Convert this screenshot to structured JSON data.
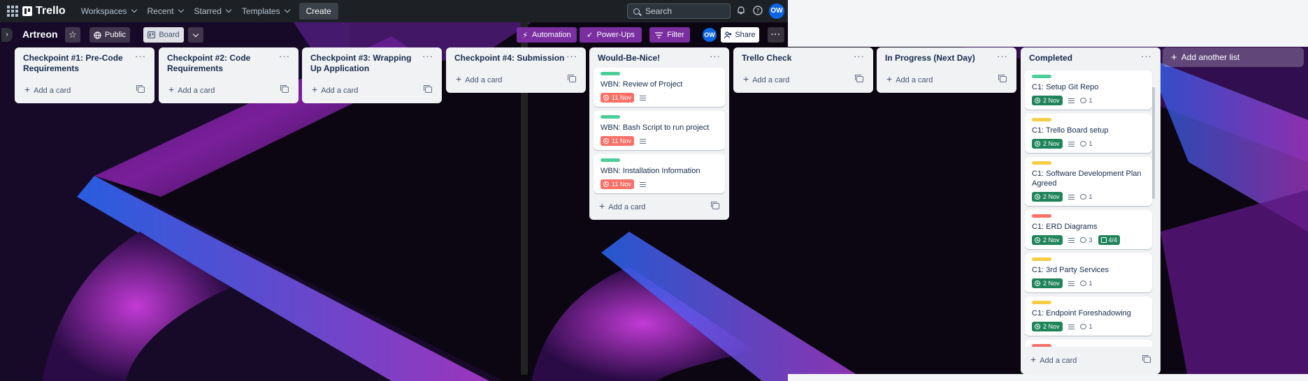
{
  "topnav": {
    "logo": "Trello",
    "items": [
      {
        "label": "Workspaces"
      },
      {
        "label": "Recent"
      },
      {
        "label": "Starred"
      },
      {
        "label": "Templates"
      }
    ],
    "create": "Create",
    "search_placeholder": "Search",
    "avatar": "OW"
  },
  "board": {
    "title": "Artreon",
    "visibility": "Public",
    "view": "Board",
    "automation": "Automation",
    "powerups": "Power-Ups",
    "filter": "Filter",
    "member_avatar": "OW",
    "share": "Share",
    "add_list": "Add another list"
  },
  "colors": {
    "green": "#4bce97",
    "yellow": "#f5cd47",
    "red": "#f87168",
    "date_green": "#1f845a",
    "date_red": "#f87168",
    "purple_accent": "#7a2ea0"
  },
  "lists": [
    {
      "title": "Checkpoint #1: Pre-Code Requirements",
      "add_card": "Add a card",
      "cards": []
    },
    {
      "title": "Checkpoint #2: Code Requirements",
      "add_card": "Add a card",
      "cards": []
    },
    {
      "title": "Checkpoint #3: Wrapping Up Application",
      "add_card": "Add a card",
      "cards": []
    },
    {
      "title": "Checkpoint #4: Submission",
      "add_card": "Add a card",
      "cards": []
    },
    {
      "title": "Would-Be-Nice!",
      "add_card": "Add a card",
      "cards": [
        {
          "label": "green",
          "title": "WBN: Review of Project",
          "date": "11 Nov",
          "date_state": "overdue"
        },
        {
          "label": "green",
          "title": "WBN: Bash Script to run project",
          "date": "11 Nov",
          "date_state": "overdue"
        },
        {
          "label": "green",
          "title": "WBN: Installation Information",
          "date": "11 Nov",
          "date_state": "overdue"
        }
      ]
    },
    {
      "title": "Trello Check",
      "add_card": "Add a card",
      "cards": []
    },
    {
      "title": "In Progress (Next Day)",
      "add_card": "Add a card",
      "cards": []
    },
    {
      "title": "Completed",
      "add_card": "Add a card",
      "cards": [
        {
          "label": "green",
          "title": "C1: Setup Git Repo",
          "date": "2 Nov",
          "date_state": "complete",
          "comments": "1"
        },
        {
          "label": "yellow",
          "title": "C1: Trello Board setup",
          "date": "2 Nov",
          "date_state": "complete",
          "comments": "1"
        },
        {
          "label": "yellow",
          "title": "C1: Software Development Plan Agreed",
          "date": "2 Nov",
          "date_state": "complete",
          "comments": "1"
        },
        {
          "label": "red",
          "title": "C1: ERD Diagrams",
          "date": "2 Nov",
          "date_state": "complete",
          "comments": "3",
          "checklist": "4/4"
        },
        {
          "label": "yellow",
          "title": "C1: 3rd Party Services",
          "date": "2 Nov",
          "date_state": "complete",
          "comments": "1"
        },
        {
          "label": "yellow",
          "title": "C1: Endpoint Foreshadowing",
          "date": "2 Nov",
          "date_state": "complete",
          "comments": "1"
        }
      ]
    }
  ]
}
